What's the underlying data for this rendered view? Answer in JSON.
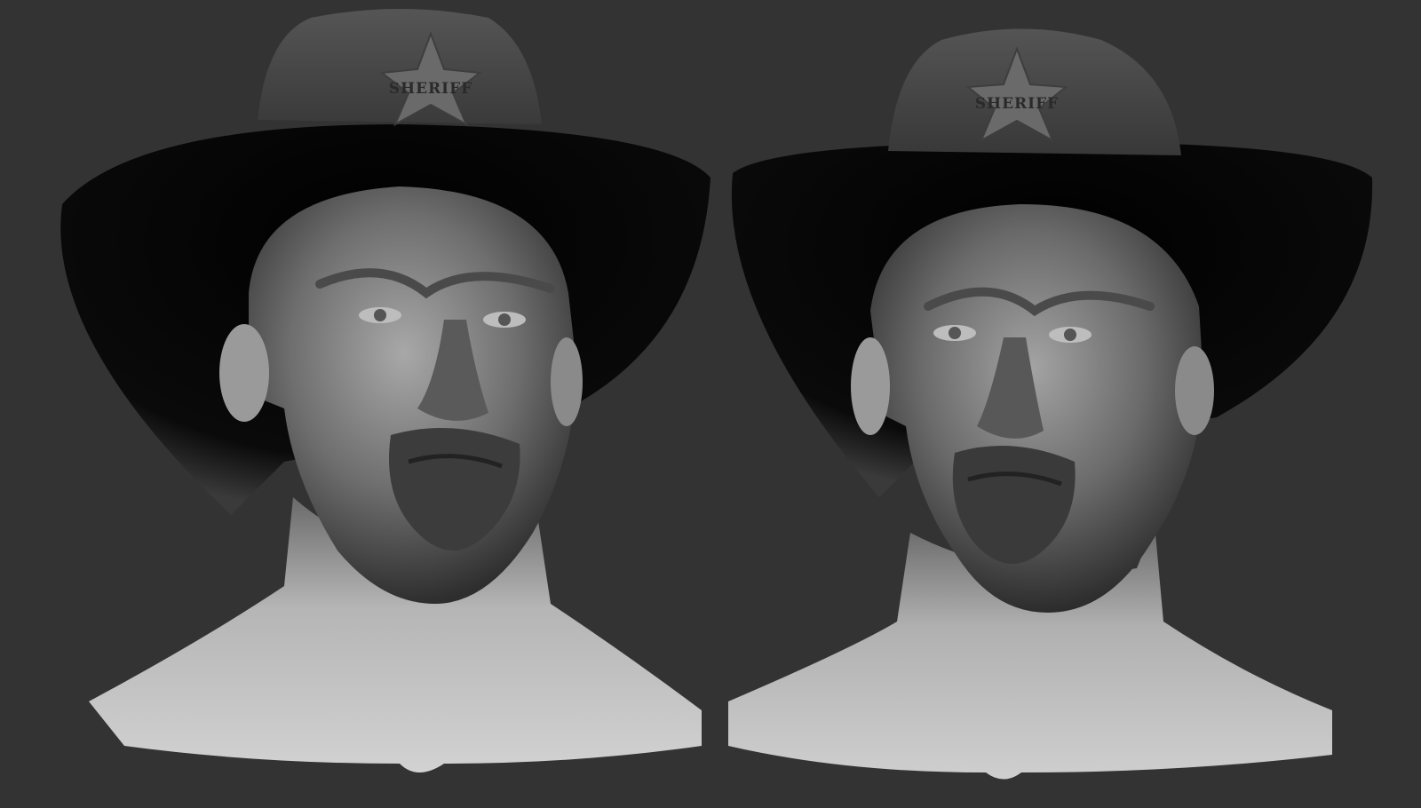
{
  "scene": {
    "background_color": "#333333",
    "view_count": 2,
    "views": [
      {
        "label": "front-view"
      },
      {
        "label": "three-quarter-view"
      }
    ]
  },
  "badge": {
    "text": "SHERIFF"
  },
  "colors": {
    "skin_light": "#c9c9c9",
    "skin_mid": "#8e8e8e",
    "skin_dark": "#3a3a3a",
    "hat_brim_inner": "#050505",
    "hat_crown": "#4a4a4a",
    "badge_metal": "#6a6a6a"
  }
}
